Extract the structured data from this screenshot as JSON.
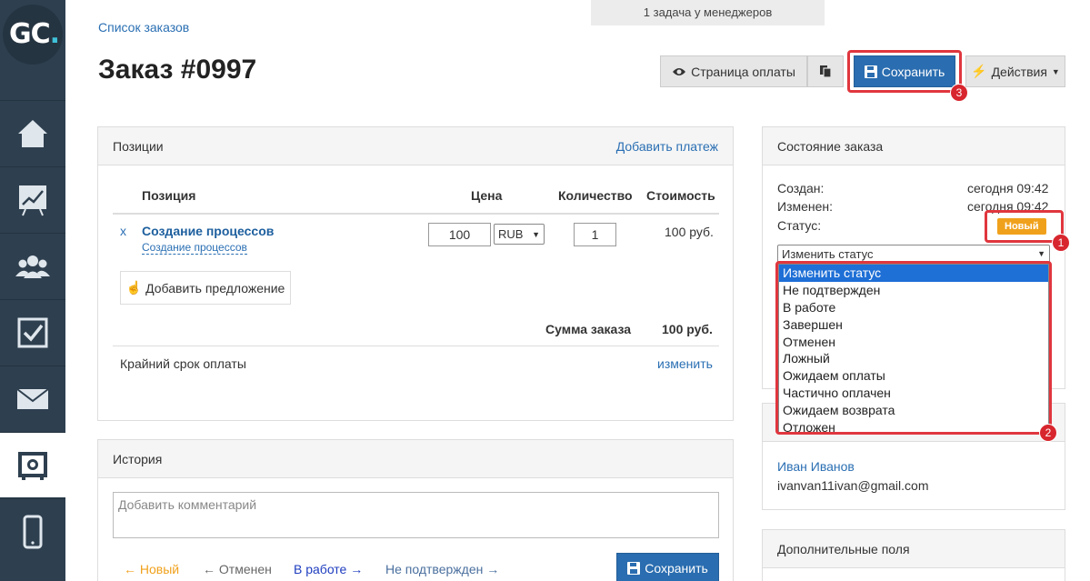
{
  "logo": {
    "text": "GC",
    "dot": "."
  },
  "nav": {
    "items": [
      "home",
      "stats",
      "users",
      "tasks",
      "mail",
      "safe",
      "mobile"
    ]
  },
  "top_tab": "1 задача у менеджеров",
  "breadcrumb": "Список заказов",
  "title": "Заказ #0997",
  "toolbar": {
    "payment_page": "Страница оплаты",
    "save": "Сохранить",
    "actions": "Действия"
  },
  "positions": {
    "title": "Позиции",
    "add_payment": "Добавить платеж",
    "headers": {
      "position": "Позиция",
      "price": "Цена",
      "qty": "Количество",
      "cost": "Стоимость"
    },
    "row": {
      "remove": "x",
      "name": "Создание процессов",
      "sub": "Создание процессов",
      "price": "100",
      "currency": "RUB",
      "qty": "1",
      "cost": "100 руб."
    },
    "add_offer": "Добавить предложение",
    "sum_label": "Сумма заказа",
    "sum_value": "100 руб.",
    "deadline_label": "Крайний срок оплаты",
    "deadline_link": "изменить"
  },
  "history": {
    "title": "История",
    "comment_placeholder": "Добавить комментарий",
    "links": [
      "← Новый",
      "← Отменен",
      "В работе →",
      "Не подтвержден →"
    ],
    "save": "Сохранить"
  },
  "order_state": {
    "title": "Состояние заказа",
    "created_label": "Создан:",
    "created_value": "сегодня 09:42",
    "changed_label": "Изменен:",
    "changed_value": "сегодня 09:42",
    "status_label": "Статус:",
    "status_badge": "Новый",
    "status_select": "Изменить статус",
    "options": [
      "Изменить статус",
      "Не подтвержден",
      "В работе",
      "Завершен",
      "Отменен",
      "Ложный",
      "Ожидаем оплаты",
      "Частично оплачен",
      "Ожидаем возврата",
      "Отложен"
    ]
  },
  "user": {
    "name": "Иван Иванов",
    "email": "ivanvan11ivan@gmail.com"
  },
  "extra_fields": {
    "title": "Дополнительные поля"
  },
  "markers": [
    "1",
    "2",
    "3"
  ],
  "colors": {
    "accent": "#2a6db0",
    "highlight": "#e0363e",
    "badge": "#f0a11c",
    "sidebar": "#2e3f4f"
  }
}
